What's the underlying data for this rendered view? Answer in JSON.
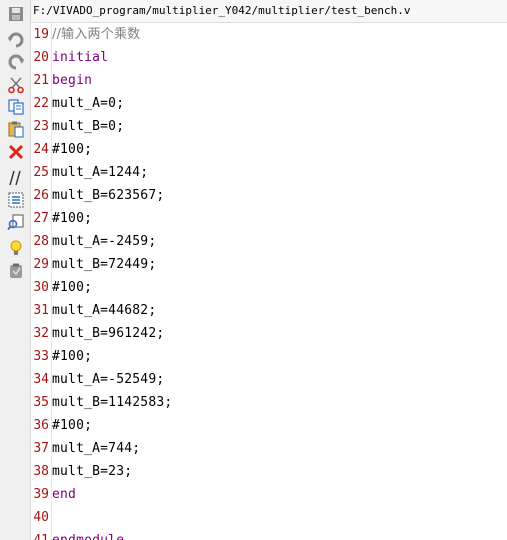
{
  "file_path": "F:/VIVADO_program/multiplier_Y042/multiplier/test_bench.v",
  "toolbar": {
    "tools": [
      {
        "name": "save-icon"
      },
      {
        "name": "undo-icon"
      },
      {
        "name": "redo-icon"
      },
      {
        "name": "cut-icon"
      },
      {
        "name": "copy-icon"
      },
      {
        "name": "paste-icon"
      },
      {
        "name": "delete-icon"
      },
      {
        "name": "comment-icon"
      },
      {
        "name": "select-all-icon"
      },
      {
        "name": "find-replace-icon"
      },
      {
        "name": "hint-bulb-icon"
      },
      {
        "name": "clipboard-icon"
      }
    ]
  },
  "colors": {
    "line_number": "#a31515",
    "keyword": "#800080",
    "comment": "#808080",
    "text": "#000000"
  },
  "lines": [
    {
      "number": "19",
      "text": "//输入两个乘数",
      "kind": "comment"
    },
    {
      "number": "20",
      "text": "initial",
      "kind": "keyword"
    },
    {
      "number": "21",
      "text": "begin",
      "kind": "keyword"
    },
    {
      "number": "22",
      "text": "mult_A=0;",
      "kind": "text"
    },
    {
      "number": "23",
      "text": "mult_B=0;",
      "kind": "text"
    },
    {
      "number": "24",
      "text": "#100;",
      "kind": "text"
    },
    {
      "number": "25",
      "text": "mult_A=1244;",
      "kind": "text"
    },
    {
      "number": "26",
      "text": "mult_B=623567;",
      "kind": "text"
    },
    {
      "number": "27",
      "text": "#100;",
      "kind": "text"
    },
    {
      "number": "28",
      "text": "mult_A=-2459;",
      "kind": "text"
    },
    {
      "number": "29",
      "text": "mult_B=72449;",
      "kind": "text"
    },
    {
      "number": "30",
      "text": "#100;",
      "kind": "text"
    },
    {
      "number": "31",
      "text": "mult_A=44682;",
      "kind": "text"
    },
    {
      "number": "32",
      "text": "mult_B=961242;",
      "kind": "text"
    },
    {
      "number": "33",
      "text": "#100;",
      "kind": "text"
    },
    {
      "number": "34",
      "text": "mult_A=-52549;",
      "kind": "text"
    },
    {
      "number": "35",
      "text": "mult_B=1142583;",
      "kind": "text"
    },
    {
      "number": "36",
      "text": "#100;",
      "kind": "text"
    },
    {
      "number": "37",
      "text": "mult_A=744;",
      "kind": "text"
    },
    {
      "number": "38",
      "text": "mult_B=23;",
      "kind": "text"
    },
    {
      "number": "39",
      "text": "end",
      "kind": "keyword"
    },
    {
      "number": "40",
      "text": "",
      "kind": "text"
    },
    {
      "number": "41",
      "text": "endmodule",
      "kind": "keyword"
    }
  ]
}
